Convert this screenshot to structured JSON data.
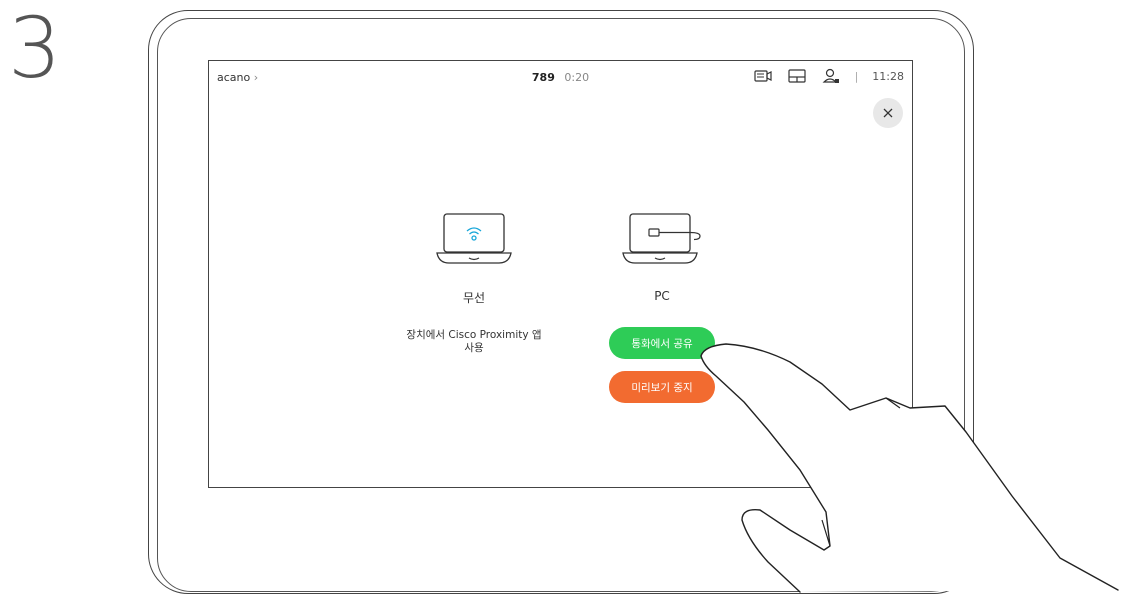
{
  "step_number": "3",
  "statusbar": {
    "left_label": "acano",
    "call_number": "789",
    "call_time": "0:20",
    "icons": [
      "camera-icon",
      "layout-icon",
      "participants-icon"
    ],
    "separator": "|",
    "clock": "11:28"
  },
  "close_icon": "close-icon",
  "options": {
    "wireless": {
      "label": "무선",
      "description_line1": "장치에서 Cisco Proximity 앱",
      "description_line2": "사용"
    },
    "pc": {
      "label": "PC"
    }
  },
  "buttons": {
    "share_label": "통화에서 공유",
    "stop_preview_label": "미리보기 중지"
  },
  "colors": {
    "share_button": "#2ecc57",
    "stop_button": "#f26b30"
  }
}
